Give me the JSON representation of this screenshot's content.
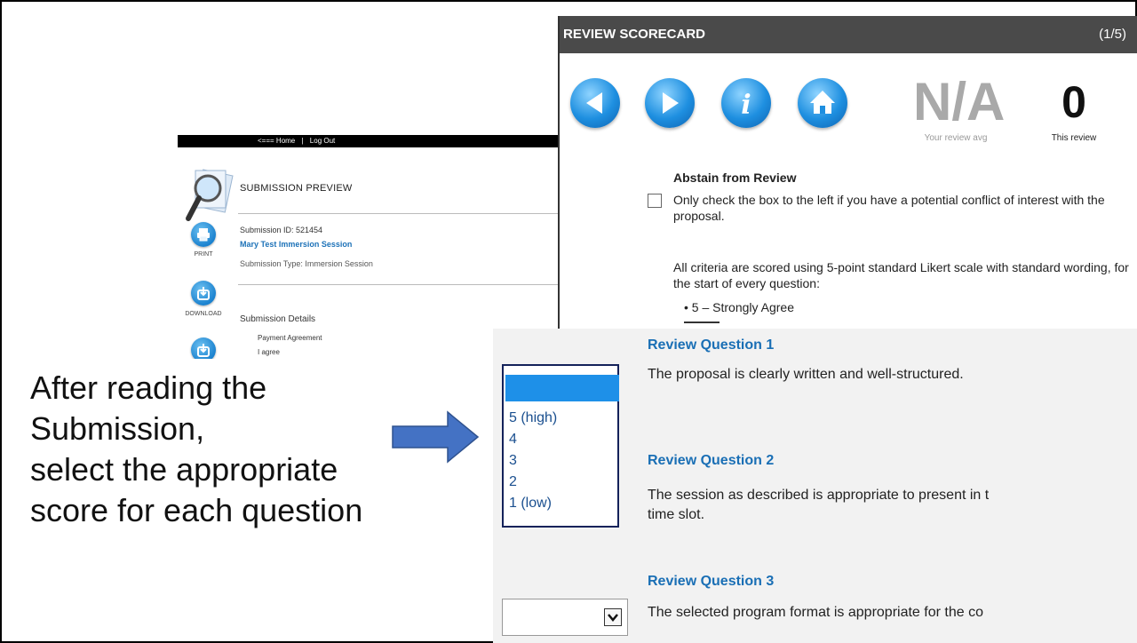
{
  "submission": {
    "topbar": {
      "home": "<=== Home",
      "sep": "|",
      "logout": "Log Out"
    },
    "title": "SUBMISSION PREVIEW",
    "submission_id": "Submission ID: 521454",
    "submission_name": "Mary Test Immersion Session",
    "submission_type": "Submission Type: Immersion Session",
    "actions": {
      "print": "PRINT",
      "download": "DOWNLOAD"
    },
    "details_heading": "Submission Details",
    "payment_label": "Payment Agreement",
    "payment_value": "I agree"
  },
  "scorecard": {
    "title": "REVIEW SCORECARD",
    "count": "(1/5)",
    "review_avg": "N/A",
    "review_avg_label": "Your review avg",
    "this_review": "0",
    "this_review_label": "This review",
    "abstain_heading": "Abstain from Review",
    "abstain_note": "Only check the box to the left if you have a potential conflict of interest with the proposal.",
    "likert_note": "All criteria are scored using 5-point standard Likert scale with standard wording, for the start of every question:",
    "bullet_first": "• 5 – Strongly Agree"
  },
  "questions": [
    {
      "title": "Review Question 1",
      "text": "The proposal is clearly written and well-structured."
    },
    {
      "title": "Review Question 2",
      "text_line1": "The session as described is appropriate to present in t",
      "text_line2": "time slot."
    },
    {
      "title": "Review Question 3",
      "text": "The selected program format is appropriate for the co"
    }
  ],
  "score_dropdown": {
    "options": [
      "5 (high)",
      "4",
      "3",
      "2",
      "1 (low)"
    ]
  },
  "annotation": {
    "lines": [
      "After reading the",
      "Submission,",
      "select the appropriate",
      "score for each question"
    ],
    "arrow_color": "#4472c4"
  },
  "colors": {
    "accent": "#1a6fb5",
    "header": "#4a4a4a",
    "dropdown_highlight": "#1e90e8"
  }
}
